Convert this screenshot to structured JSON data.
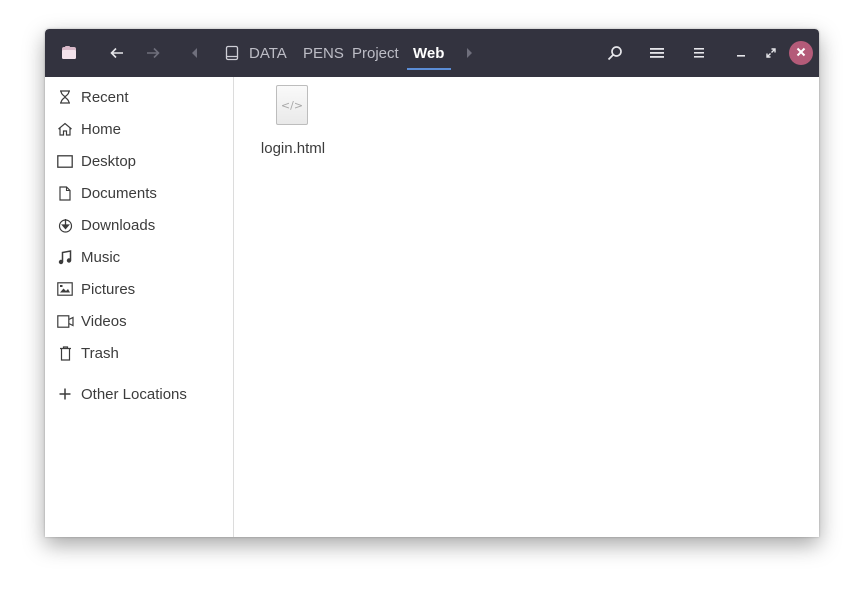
{
  "headerbar": {
    "back_icon": "arrow-left-icon",
    "forward_icon": "arrow-right-icon",
    "breadcrumb_left_icon": "chevron-left-icon",
    "breadcrumb_right_icon": "chevron-right-icon",
    "drive_icon": "drive-icon",
    "breadcrumbs": [
      {
        "label": "DATA"
      },
      {
        "label": "PENS"
      },
      {
        "label": "Project"
      },
      {
        "label": "Web",
        "active": true
      }
    ],
    "search_icon": "search-icon",
    "view_toggle_icon": "list-view-icon",
    "menu_icon": "hamburger-menu-icon",
    "minimize_icon": "minimize-icon",
    "maximize_icon": "maximize-icon",
    "close_icon": "close-icon"
  },
  "sidebar": {
    "items": [
      {
        "label": "Recent",
        "icon": "hourglass-icon"
      },
      {
        "label": "Home",
        "icon": "home-icon"
      },
      {
        "label": "Desktop",
        "icon": "desktop-icon"
      },
      {
        "label": "Documents",
        "icon": "document-icon"
      },
      {
        "label": "Downloads",
        "icon": "download-icon"
      },
      {
        "label": "Music",
        "icon": "music-note-icon"
      },
      {
        "label": "Pictures",
        "icon": "picture-icon"
      },
      {
        "label": "Videos",
        "icon": "video-camera-icon"
      },
      {
        "label": "Trash",
        "icon": "trash-icon"
      }
    ],
    "other_locations": {
      "label": "Other Locations",
      "icon": "plus-icon"
    }
  },
  "files": [
    {
      "name": "login.html",
      "icon": "html-file-icon",
      "glyph": "</>"
    }
  ],
  "colors": {
    "headerbar": "#33333f",
    "close_button": "#b45b79",
    "active_underline": "#5b8dd6"
  }
}
